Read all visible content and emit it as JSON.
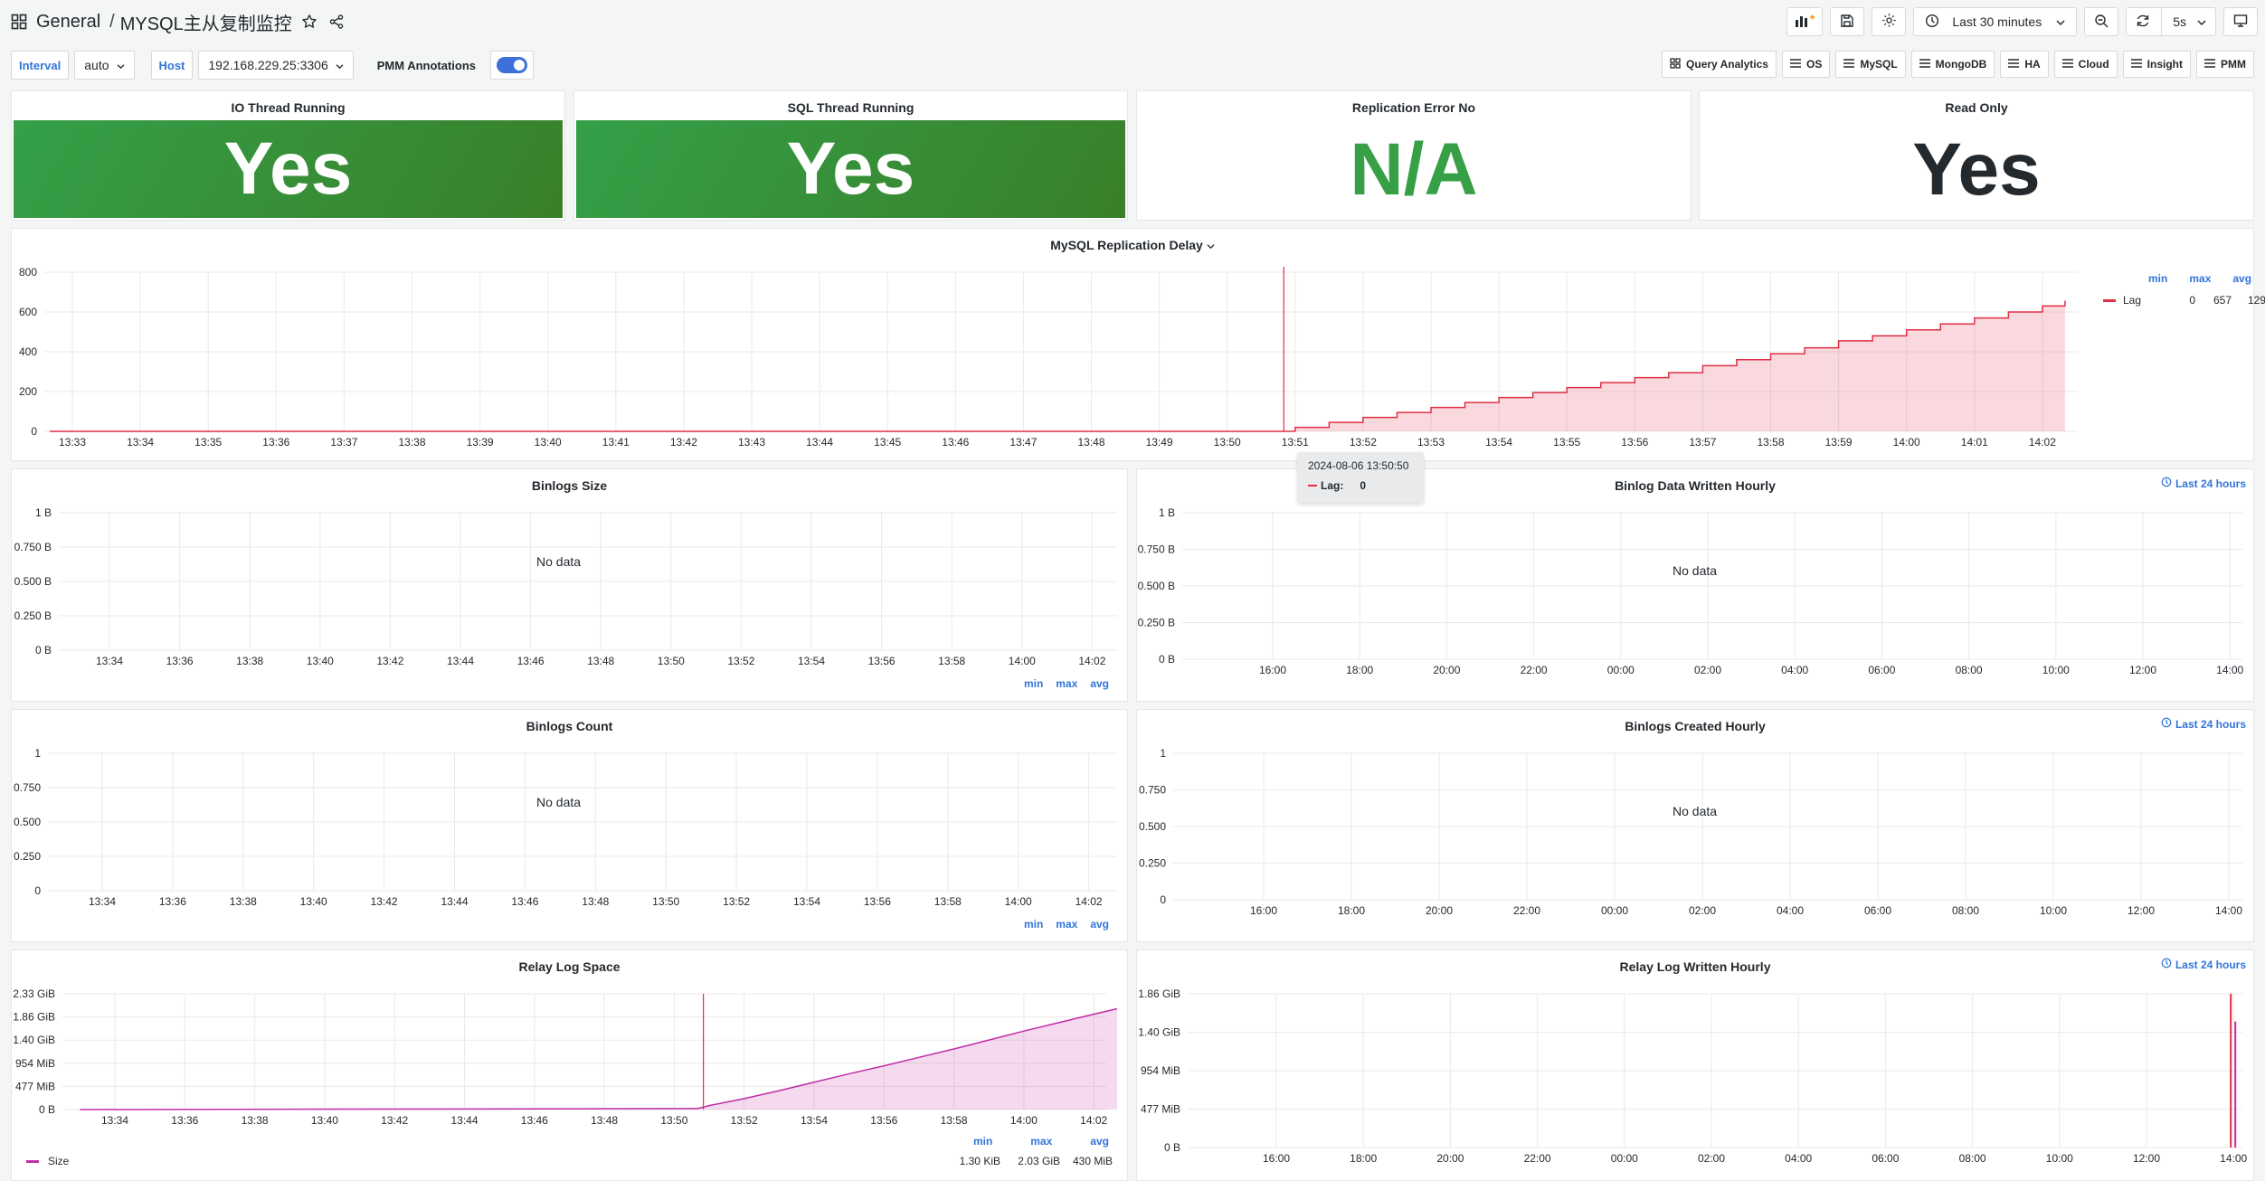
{
  "header": {
    "breadcrumb_folder": "General",
    "breadcrumb_title": "MYSQL主从复制监控",
    "time_range": "Last 30 minutes",
    "refresh_interval": "5s"
  },
  "variables": {
    "interval_label": "Interval",
    "interval_value": "auto",
    "host_label": "Host",
    "host_value": "192.168.229.25:3306",
    "annotations_label": "PMM Annotations"
  },
  "links": [
    "Query Analytics",
    "OS",
    "MySQL",
    "MongoDB",
    "HA",
    "Cloud",
    "Insight",
    "PMM"
  ],
  "colors": {
    "accent": "#3274d9",
    "ok_green": "#37a046",
    "lag_red": "#e02f44",
    "relay_pink": "#c02ea6"
  },
  "stats": [
    {
      "title": "IO Thread Running",
      "value": "Yes"
    },
    {
      "title": "SQL Thread Running",
      "value": "Yes"
    },
    {
      "title": "Replication Error No",
      "value": "N/A"
    },
    {
      "title": "Read Only",
      "value": "Yes"
    }
  ],
  "tooltip": {
    "time": "2024-08-06 13:50:50",
    "series": "Lag:",
    "value": "0"
  },
  "legend_headers": {
    "min": "min",
    "max": "max",
    "avg": "avg"
  },
  "last24": "Last 24 hours",
  "no_data": "No data",
  "panels": {
    "replication_delay": {
      "title": "MySQL Replication Delay",
      "yticks": [
        "800",
        "600",
        "400",
        "200",
        "0"
      ],
      "xticks": [
        "13:33",
        "13:34",
        "13:35",
        "13:36",
        "13:37",
        "13:38",
        "13:39",
        "13:40",
        "13:41",
        "13:42",
        "13:43",
        "13:44",
        "13:45",
        "13:46",
        "13:47",
        "13:48",
        "13:49",
        "13:50",
        "13:51",
        "13:52",
        "13:53",
        "13:54",
        "13:55",
        "13:56",
        "13:57",
        "13:58",
        "13:59",
        "14:00",
        "14:01",
        "14:02"
      ],
      "legend": {
        "name": "Lag",
        "min": "0",
        "max": "657",
        "avg": "129"
      }
    },
    "binlogs_size": {
      "title": "Binlogs Size",
      "yticks": [
        "1 B",
        "0.750 B",
        "0.500 B",
        "0.250 B",
        "0 B"
      ],
      "xticks": [
        "13:34",
        "13:36",
        "13:38",
        "13:40",
        "13:42",
        "13:44",
        "13:46",
        "13:48",
        "13:50",
        "13:52",
        "13:54",
        "13:56",
        "13:58",
        "14:00",
        "14:02"
      ]
    },
    "binlog_written": {
      "title": "Binlog Data Written Hourly",
      "yticks": [
        "1 B",
        "0.750 B",
        "0.500 B",
        "0.250 B",
        "0 B"
      ],
      "xticks": [
        "16:00",
        "18:00",
        "20:00",
        "22:00",
        "00:00",
        "02:00",
        "04:00",
        "06:00",
        "08:00",
        "10:00",
        "12:00",
        "14:00"
      ]
    },
    "binlogs_count": {
      "title": "Binlogs Count",
      "yticks": [
        "1",
        "0.750",
        "0.500",
        "0.250",
        "0"
      ],
      "xticks": [
        "13:34",
        "13:36",
        "13:38",
        "13:40",
        "13:42",
        "13:44",
        "13:46",
        "13:48",
        "13:50",
        "13:52",
        "13:54",
        "13:56",
        "13:58",
        "14:00",
        "14:02"
      ]
    },
    "binlogs_created": {
      "title": "Binlogs Created Hourly",
      "yticks": [
        "1",
        "0.750",
        "0.500",
        "0.250",
        "0"
      ],
      "xticks": [
        "16:00",
        "18:00",
        "20:00",
        "22:00",
        "00:00",
        "02:00",
        "04:00",
        "06:00",
        "08:00",
        "10:00",
        "12:00",
        "14:00"
      ]
    },
    "relay_log_space": {
      "title": "Relay Log Space",
      "yticks": [
        "2.33 GiB",
        "1.86 GiB",
        "1.40 GiB",
        "954 MiB",
        "477 MiB",
        "0 B"
      ],
      "xticks": [
        "13:34",
        "13:36",
        "13:38",
        "13:40",
        "13:42",
        "13:44",
        "13:46",
        "13:48",
        "13:50",
        "13:52",
        "13:54",
        "13:56",
        "13:58",
        "14:00",
        "14:02"
      ],
      "legend": {
        "name": "Size",
        "min": "1.30 KiB",
        "max": "2.03 GiB",
        "avg": "430 MiB"
      }
    },
    "relay_written": {
      "title": "Relay Log Written Hourly",
      "yticks": [
        "1.86 GiB",
        "1.40 GiB",
        "954 MiB",
        "477 MiB",
        "0 B"
      ],
      "xticks": [
        "16:00",
        "18:00",
        "20:00",
        "22:00",
        "00:00",
        "02:00",
        "04:00",
        "06:00",
        "08:00",
        "10:00",
        "12:00",
        "14:00"
      ]
    }
  },
  "chart_data": [
    {
      "type": "area",
      "title": "MySQL Replication Delay",
      "x_unit": "time",
      "ylim": [
        0,
        800
      ],
      "series": [
        {
          "name": "Lag",
          "points": [
            [
              "13:32:40",
              0
            ],
            [
              "13:50:50",
              0
            ],
            [
              "13:51:00",
              20
            ],
            [
              "13:51:30",
              45
            ],
            [
              "13:52:00",
              70
            ],
            [
              "13:52:30",
              95
            ],
            [
              "13:53:00",
              120
            ],
            [
              "13:53:30",
              145
            ],
            [
              "13:54:00",
              170
            ],
            [
              "13:54:30",
              195
            ],
            [
              "13:55:00",
              220
            ],
            [
              "13:55:30",
              245
            ],
            [
              "13:56:00",
              270
            ],
            [
              "13:56:30",
              295
            ],
            [
              "13:57:00",
              330
            ],
            [
              "13:57:30",
              360
            ],
            [
              "13:58:00",
              390
            ],
            [
              "13:58:30",
              420
            ],
            [
              "13:59:00",
              455
            ],
            [
              "13:59:30",
              480
            ],
            [
              "14:00:00",
              510
            ],
            [
              "14:00:30",
              540
            ],
            [
              "14:01:00",
              570
            ],
            [
              "14:01:30",
              600
            ],
            [
              "14:02:00",
              630
            ],
            [
              "14:02:20",
              657
            ]
          ]
        }
      ]
    },
    {
      "type": "area",
      "title": "Relay Log Space",
      "x_unit": "time",
      "y_unit": "GiB",
      "ylim": [
        0,
        2.33
      ],
      "series": [
        {
          "name": "Size",
          "points": [
            [
              "13:33:00",
              0.0
            ],
            [
              "13:50:40",
              0.02
            ],
            [
              "13:51:00",
              0.08
            ],
            [
              "13:52:00",
              0.22
            ],
            [
              "13:53:00",
              0.38
            ],
            [
              "13:54:00",
              0.55
            ],
            [
              "13:55:00",
              0.72
            ],
            [
              "13:56:00",
              0.88
            ],
            [
              "13:57:00",
              1.05
            ],
            [
              "13:58:00",
              1.22
            ],
            [
              "13:59:00",
              1.4
            ],
            [
              "14:00:00",
              1.58
            ],
            [
              "14:01:00",
              1.75
            ],
            [
              "14:02:00",
              1.92
            ],
            [
              "14:02:40",
              2.03
            ]
          ]
        }
      ]
    },
    {
      "type": "bar",
      "title": "Relay Log Written Hourly",
      "y_unit": "GiB",
      "ylim": [
        0,
        1.86
      ],
      "x": [
        "14:00"
      ],
      "values": [
        1.86
      ]
    }
  ]
}
